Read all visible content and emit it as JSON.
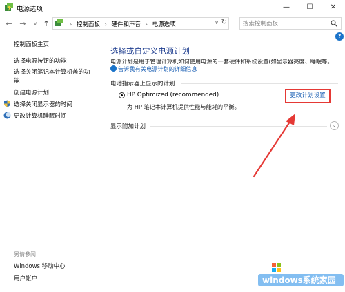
{
  "window": {
    "title": "电源选项",
    "minimize": "—",
    "maximize": "☐",
    "close": "✕"
  },
  "nav": {
    "back": "←",
    "forward": "→",
    "recent": "∨",
    "up": "↑"
  },
  "breadcrumb": {
    "items": [
      "控制面板",
      "硬件和声音",
      "电源选项"
    ],
    "separator": "›",
    "dropdown": "∨",
    "refresh": "↻"
  },
  "search": {
    "placeholder": "搜索控制面板"
  },
  "help": "?",
  "sidebar": {
    "items": [
      {
        "label": "控制面板主页"
      },
      {
        "label": "选择电源按钮的功能"
      },
      {
        "label": "选择关闭笔记本计算机盖的功"
      },
      {
        "label": "能"
      },
      {
        "label": "创建电源计划"
      },
      {
        "label": "选择关闭显示器的时间"
      },
      {
        "label": "更改计算机睡眠时间"
      }
    ],
    "see_also": "另请参阅",
    "bottom": [
      {
        "label": "Windows 移动中心"
      },
      {
        "label": "用户帐户"
      }
    ]
  },
  "main": {
    "title": "选择或自定义电源计划",
    "description": "电源计划是用于管理计算机如何使用电源的一套硬件和系统设置(如显示器亮度、睡眠等。",
    "description_link": "告诉我有关电源计划的详细信息",
    "battery_section": "电池指示器上显示的计划",
    "plan_name": "HP Optimized (recommended)",
    "plan_desc": "为 HP 笔记本计算机提供性能与能耗的平衡。",
    "change_plan": "更改计划设置",
    "extra_plans": "显示附加计划"
  },
  "watermark": {
    "text": "windows系统家园"
  },
  "colors": {
    "accent_link": "#1a5fb4",
    "title_blue": "#1e3d8f",
    "highlight_red": "#e53935"
  }
}
